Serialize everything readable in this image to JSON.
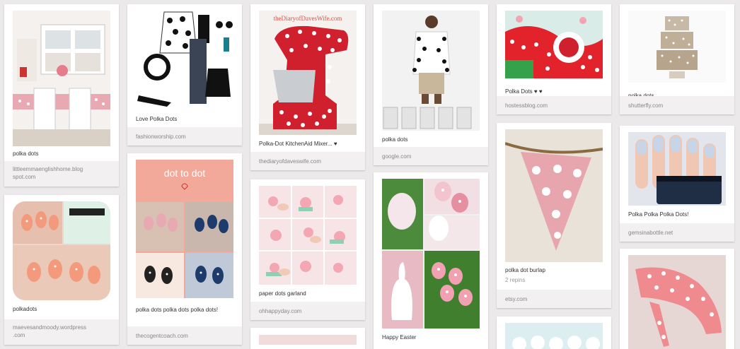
{
  "pins": [
    {
      "id": "kitchen",
      "description": "polka dots",
      "source": [
        "littleemmaenglishhome.blog",
        "spot.com"
      ],
      "image": "kitchen-photo"
    },
    {
      "id": "outfit",
      "description": "Love Polka Dots",
      "source": [
        "fashionworship.com"
      ],
      "image": "outfit-collage"
    },
    {
      "id": "mixer",
      "description": "Polka-Dot KitchenAid Mixer... ♥",
      "source": [
        "thediaryofdaveswife.com"
      ],
      "image": "mixer-photo",
      "watermark": "theDiaryofDavesWife.com"
    },
    {
      "id": "model",
      "description": "polka dots",
      "source": [
        "google.com"
      ],
      "image": "model-photo"
    },
    {
      "id": "party",
      "description": "Polka Dots ♥ ♥",
      "source": [
        "hostessblog.com"
      ],
      "image": "party-photo"
    },
    {
      "id": "cake",
      "description": "polka dots",
      "source": [
        "shutterfly.com"
      ],
      "image": "cake-photo"
    },
    {
      "id": "nails1",
      "description": "polkadots",
      "source": [
        "maevesandmoody.wordpress",
        ".com"
      ],
      "image": "nails-collage"
    },
    {
      "id": "dot2dot",
      "description": "polka dots polka dots polka dots!",
      "source": [
        "thecogentcoach.com"
      ],
      "image": "dot-to-dot-collage",
      "title_text": "dot to dot"
    },
    {
      "id": "garland",
      "description": "paper dots garland",
      "source": [
        "ohhappyday.com"
      ],
      "image": "garland-steps"
    },
    {
      "id": "eggs",
      "description": "Happy Easter",
      "source": [],
      "image": "easter-eggs-collage"
    },
    {
      "id": "burlap",
      "description": "polka dot burlap",
      "repins": "2 repins",
      "source": [
        "etsy.com"
      ],
      "image": "burlap-banner"
    },
    {
      "id": "nails2",
      "description": "Polka Polka Polka Dots!",
      "source": [
        "gemsinabottle.net"
      ],
      "image": "nails-bottle"
    },
    {
      "id": "heels",
      "description": "",
      "source": [],
      "image": "heels-photo"
    },
    {
      "id": "cupcakes",
      "description": "",
      "source": [],
      "image": "cupcake-photo"
    },
    {
      "id": "partial3",
      "description": "",
      "source": [],
      "image": "partial-photo"
    }
  ],
  "colors": {
    "background": "#ebe9e9",
    "card": "#ffffff",
    "source_bar": "#f2f0f0",
    "accent_red": "#d0202e"
  }
}
